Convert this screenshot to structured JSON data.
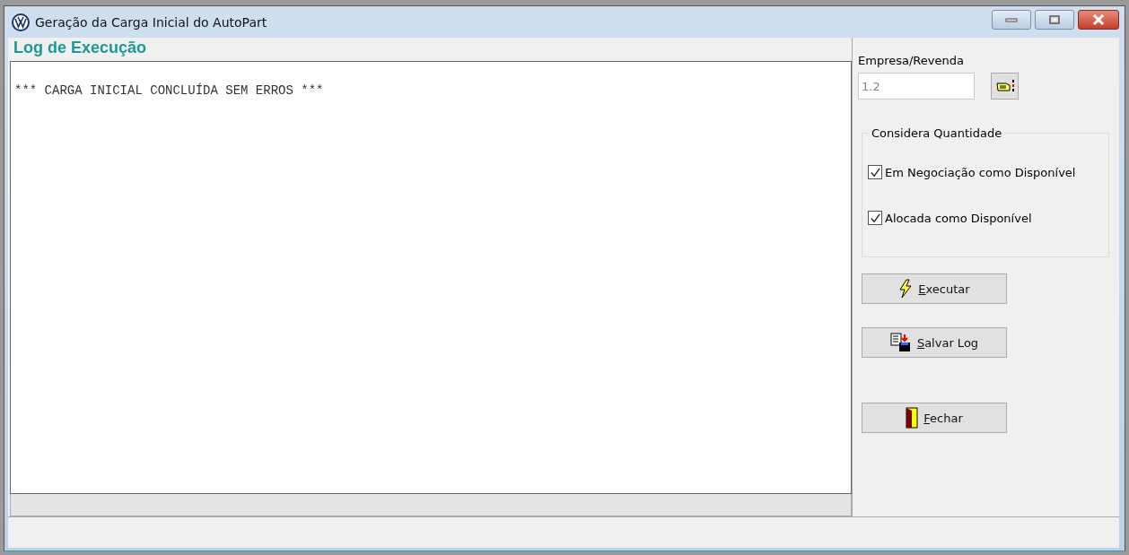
{
  "window": {
    "title": "Geração da Carga Inicial do AutoPart"
  },
  "log": {
    "heading": "Log de Execução",
    "lines": [
      "*** CARGA INICIAL CONCLUÍDA SEM ERROS ***"
    ]
  },
  "empresa": {
    "label": "Empresa/Revenda",
    "value": "1.2",
    "disabled": true
  },
  "quantidade": {
    "title": "Considera Quantidade",
    "options": [
      {
        "label": "Em Negociação como Disponível",
        "checked": true
      },
      {
        "label": "Alocada como Disponível",
        "checked": true
      }
    ]
  },
  "buttons": [
    {
      "label": "Executar",
      "kind": "run"
    },
    {
      "label": "Salvar Log",
      "kind": "save"
    },
    {
      "label": "Fechar",
      "kind": "close"
    }
  ]
}
